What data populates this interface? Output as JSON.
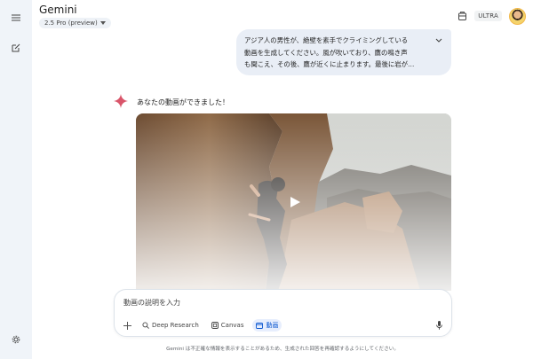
{
  "app": {
    "title": "Gemini",
    "model_label": "2.5 Pro (preview)",
    "plan_badge": "ULTRA"
  },
  "sidebar": {
    "menu_icon": "menu-icon",
    "new_chat_icon": "edit-icon",
    "settings_icon": "gear-icon"
  },
  "chat": {
    "user_prompt_lines": [
      "アジア人の男性が、絶壁を素手でクライミングしている",
      "動画を生成してください。風が吹いており、鷹の鳴き声",
      "も聞こえ、その後、鷹が近くに止まります。最後に岩が…"
    ],
    "assistant_text": "あなたの動画ができました！"
  },
  "composer": {
    "placeholder": "動画の説明を入力",
    "tools": {
      "deep_research": "Deep Research",
      "canvas": "Canvas",
      "video": "動画"
    }
  },
  "footer": {
    "disclaimer": "Gemini は不正確な情報を表示することがあるため、生成された回答を再確認するようにしてください。"
  },
  "colors": {
    "sidebar_bg": "#f0f4f9",
    "bubble_bg": "#e9eef6",
    "accent_blue": "#0b57d0",
    "spark_color": "#d9556a"
  }
}
